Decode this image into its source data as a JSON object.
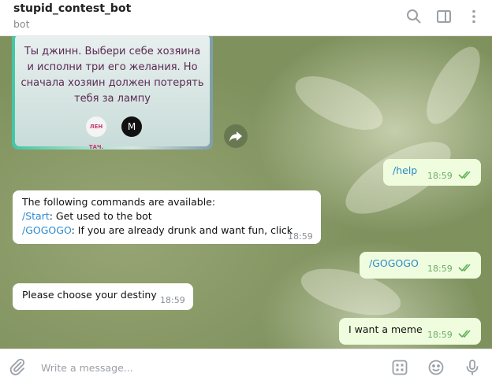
{
  "header": {
    "title": "stupid_contest_bot",
    "subtitle": "bot",
    "icons": [
      "search-icon",
      "sidebar-toggle-icon",
      "more-vertical-icon"
    ]
  },
  "card": {
    "text_line1": "Ты джинн. Выбери себе хозяина",
    "text_line2": "и исполни три его желания. Но",
    "text_line3": "сначала хозяин должен потерять",
    "text_line4": "тебя за лампу",
    "logo_a": "ЛЕН ТАЧ.",
    "logo_b": "M",
    "icons": [
      "forward-icon"
    ]
  },
  "messages": [
    {
      "direction": "out",
      "text": "/help",
      "time": "18:59",
      "read": true
    },
    {
      "direction": "in",
      "line1": "The following commands are available:",
      "line2_cmd": "/Start",
      "line2_text": ": Get used to the bot",
      "line3_cmd": "/GOGOGO",
      "line3_text": ": If you are already drunk and want fun, click",
      "time": "18:59"
    },
    {
      "direction": "out",
      "text": "/GOGOGO",
      "time": "18:59",
      "read": true
    },
    {
      "direction": "in",
      "text": "Please choose your destiny",
      "time": "18:59"
    },
    {
      "direction": "out",
      "text": "I want a meme",
      "time": "18:59",
      "read": true
    }
  ],
  "input": {
    "placeholder": "Write a message...",
    "value": "",
    "icons": [
      "attach-icon",
      "bot-commands-icon",
      "emoji-icon",
      "microphone-icon"
    ]
  },
  "colors": {
    "outgoing_bubble": "#effdde",
    "incoming_bubble": "#ffffff",
    "link": "#2b8acb",
    "read_ticks": "#5fb05a"
  }
}
